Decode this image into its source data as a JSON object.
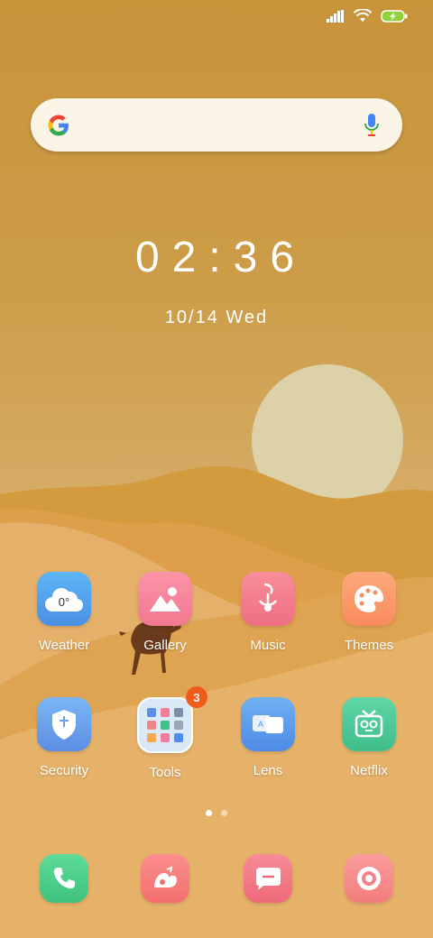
{
  "status_bar": {
    "icons": [
      "signal-icon",
      "wifi-icon",
      "battery-charging-icon"
    ]
  },
  "search": {
    "logo": "google-logo",
    "mic": "microphone-icon"
  },
  "clock": {
    "time": "02:36",
    "date": "10/14 Wed"
  },
  "apps_row1": [
    {
      "label": "Weather",
      "icon": "weather-cloud-icon",
      "icon_text": "0°",
      "color": "#52a8ee"
    },
    {
      "label": "Gallery",
      "icon": "gallery-icon",
      "color": "#f7869b"
    },
    {
      "label": "Music",
      "icon": "music-icon",
      "color": "#f37f8e"
    },
    {
      "label": "Themes",
      "icon": "palette-icon",
      "color": "#fb9a6a"
    }
  ],
  "apps_row2": [
    {
      "label": "Security",
      "icon": "shield-icon",
      "color": "#6ca8ee"
    },
    {
      "label": "Tools",
      "icon": "folder-icon",
      "badge": "3",
      "color": "#cfe4f7"
    },
    {
      "label": "Lens",
      "icon": "lens-icon",
      "color": "#5d9eea"
    },
    {
      "label": "Netflix",
      "icon": "netflix-icon",
      "color": "#4dcb9a"
    }
  ],
  "dock": [
    {
      "icon": "phone-icon",
      "color": "#4fd08b"
    },
    {
      "icon": "browser-icon",
      "color": "#f77f7f"
    },
    {
      "icon": "messages-icon",
      "color": "#f37985"
    },
    {
      "icon": "camera-icon",
      "color": "#f68d8d"
    }
  ],
  "pages": {
    "count": 2,
    "active": 0
  }
}
